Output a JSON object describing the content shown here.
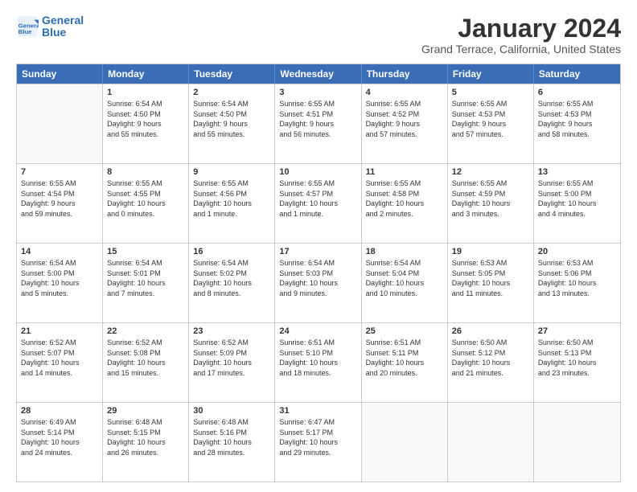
{
  "logo": {
    "line1": "General",
    "line2": "Blue"
  },
  "title": "January 2024",
  "subtitle": "Grand Terrace, California, United States",
  "header_days": [
    "Sunday",
    "Monday",
    "Tuesday",
    "Wednesday",
    "Thursday",
    "Friday",
    "Saturday"
  ],
  "weeks": [
    [
      {
        "day": "",
        "info": "",
        "empty": true
      },
      {
        "day": "1",
        "info": "Sunrise: 6:54 AM\nSunset: 4:50 PM\nDaylight: 9 hours\nand 55 minutes."
      },
      {
        "day": "2",
        "info": "Sunrise: 6:54 AM\nSunset: 4:50 PM\nDaylight: 9 hours\nand 55 minutes."
      },
      {
        "day": "3",
        "info": "Sunrise: 6:55 AM\nSunset: 4:51 PM\nDaylight: 9 hours\nand 56 minutes."
      },
      {
        "day": "4",
        "info": "Sunrise: 6:55 AM\nSunset: 4:52 PM\nDaylight: 9 hours\nand 57 minutes."
      },
      {
        "day": "5",
        "info": "Sunrise: 6:55 AM\nSunset: 4:53 PM\nDaylight: 9 hours\nand 57 minutes."
      },
      {
        "day": "6",
        "info": "Sunrise: 6:55 AM\nSunset: 4:53 PM\nDaylight: 9 hours\nand 58 minutes."
      }
    ],
    [
      {
        "day": "7",
        "info": "Sunrise: 6:55 AM\nSunset: 4:54 PM\nDaylight: 9 hours\nand 59 minutes."
      },
      {
        "day": "8",
        "info": "Sunrise: 6:55 AM\nSunset: 4:55 PM\nDaylight: 10 hours\nand 0 minutes."
      },
      {
        "day": "9",
        "info": "Sunrise: 6:55 AM\nSunset: 4:56 PM\nDaylight: 10 hours\nand 1 minute."
      },
      {
        "day": "10",
        "info": "Sunrise: 6:55 AM\nSunset: 4:57 PM\nDaylight: 10 hours\nand 1 minute."
      },
      {
        "day": "11",
        "info": "Sunrise: 6:55 AM\nSunset: 4:58 PM\nDaylight: 10 hours\nand 2 minutes."
      },
      {
        "day": "12",
        "info": "Sunrise: 6:55 AM\nSunset: 4:59 PM\nDaylight: 10 hours\nand 3 minutes."
      },
      {
        "day": "13",
        "info": "Sunrise: 6:55 AM\nSunset: 5:00 PM\nDaylight: 10 hours\nand 4 minutes."
      }
    ],
    [
      {
        "day": "14",
        "info": "Sunrise: 6:54 AM\nSunset: 5:00 PM\nDaylight: 10 hours\nand 5 minutes."
      },
      {
        "day": "15",
        "info": "Sunrise: 6:54 AM\nSunset: 5:01 PM\nDaylight: 10 hours\nand 7 minutes."
      },
      {
        "day": "16",
        "info": "Sunrise: 6:54 AM\nSunset: 5:02 PM\nDaylight: 10 hours\nand 8 minutes."
      },
      {
        "day": "17",
        "info": "Sunrise: 6:54 AM\nSunset: 5:03 PM\nDaylight: 10 hours\nand 9 minutes."
      },
      {
        "day": "18",
        "info": "Sunrise: 6:54 AM\nSunset: 5:04 PM\nDaylight: 10 hours\nand 10 minutes."
      },
      {
        "day": "19",
        "info": "Sunrise: 6:53 AM\nSunset: 5:05 PM\nDaylight: 10 hours\nand 11 minutes."
      },
      {
        "day": "20",
        "info": "Sunrise: 6:53 AM\nSunset: 5:06 PM\nDaylight: 10 hours\nand 13 minutes."
      }
    ],
    [
      {
        "day": "21",
        "info": "Sunrise: 6:52 AM\nSunset: 5:07 PM\nDaylight: 10 hours\nand 14 minutes."
      },
      {
        "day": "22",
        "info": "Sunrise: 6:52 AM\nSunset: 5:08 PM\nDaylight: 10 hours\nand 15 minutes."
      },
      {
        "day": "23",
        "info": "Sunrise: 6:52 AM\nSunset: 5:09 PM\nDaylight: 10 hours\nand 17 minutes."
      },
      {
        "day": "24",
        "info": "Sunrise: 6:51 AM\nSunset: 5:10 PM\nDaylight: 10 hours\nand 18 minutes."
      },
      {
        "day": "25",
        "info": "Sunrise: 6:51 AM\nSunset: 5:11 PM\nDaylight: 10 hours\nand 20 minutes."
      },
      {
        "day": "26",
        "info": "Sunrise: 6:50 AM\nSunset: 5:12 PM\nDaylight: 10 hours\nand 21 minutes."
      },
      {
        "day": "27",
        "info": "Sunrise: 6:50 AM\nSunset: 5:13 PM\nDaylight: 10 hours\nand 23 minutes."
      }
    ],
    [
      {
        "day": "28",
        "info": "Sunrise: 6:49 AM\nSunset: 5:14 PM\nDaylight: 10 hours\nand 24 minutes."
      },
      {
        "day": "29",
        "info": "Sunrise: 6:48 AM\nSunset: 5:15 PM\nDaylight: 10 hours\nand 26 minutes."
      },
      {
        "day": "30",
        "info": "Sunrise: 6:48 AM\nSunset: 5:16 PM\nDaylight: 10 hours\nand 28 minutes."
      },
      {
        "day": "31",
        "info": "Sunrise: 6:47 AM\nSunset: 5:17 PM\nDaylight: 10 hours\nand 29 minutes."
      },
      {
        "day": "",
        "info": "",
        "empty": true
      },
      {
        "day": "",
        "info": "",
        "empty": true
      },
      {
        "day": "",
        "info": "",
        "empty": true
      }
    ]
  ]
}
